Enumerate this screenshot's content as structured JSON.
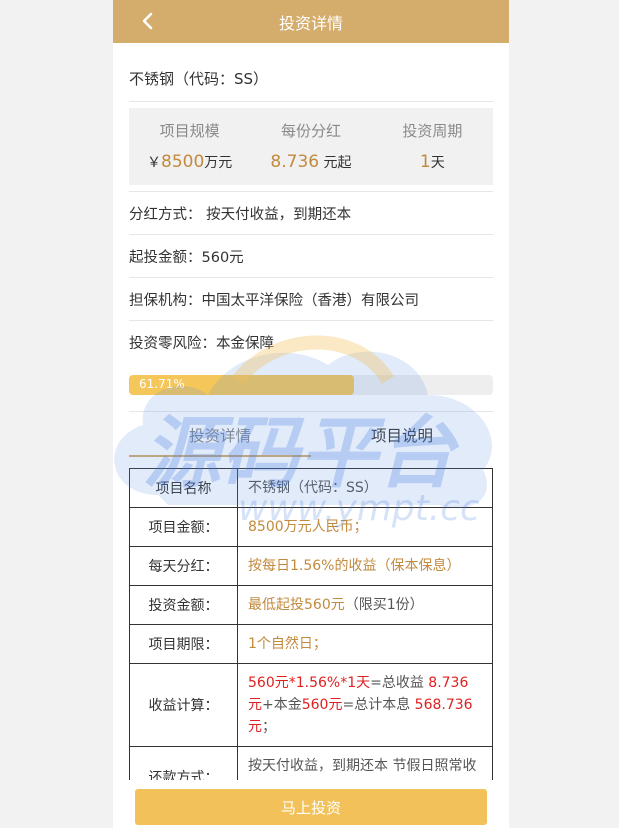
{
  "header": {
    "title": "投资详情"
  },
  "project": {
    "name": "不锈钢（代码：SS）"
  },
  "stats": [
    {
      "label": "项目规模",
      "prefix": "￥",
      "value": "8500",
      "unit": "万元"
    },
    {
      "label": "每份分红",
      "prefix": "",
      "value": "8.736",
      "unit": " 元起"
    },
    {
      "label": "投资周期",
      "prefix": "",
      "value": "1",
      "unit": "天"
    }
  ],
  "info": [
    {
      "label": "分红方式：",
      "value": "按天付收益，到期还本"
    },
    {
      "label": "起投金额：",
      "value": "560元"
    },
    {
      "label": "担保机构：",
      "value": "中国太平洋保险（香港）有限公司"
    },
    {
      "label": "投资零风险：",
      "value": "本金保障"
    }
  ],
  "progress": {
    "percent": 61.71,
    "text": "61.71%"
  },
  "tabs": [
    {
      "label": "投资详情",
      "active": true
    },
    {
      "label": "项目说明",
      "active": false
    }
  ],
  "table": {
    "header_key": "项目名称",
    "header_val": "不锈钢（代码：SS）",
    "rows": [
      {
        "key": "项目金额：",
        "val": "8500万元人民币；"
      },
      {
        "key": "每天分红：",
        "val": "按每日1.56%的收益（保本保息）"
      },
      {
        "key": "投资金额：",
        "val_a": "最低起投560元",
        "val_b": "（限买1份）"
      },
      {
        "key": "项目期限：",
        "val": "1个自然日；"
      },
      {
        "key": "收益计算：",
        "p1": "560元*1.56%*1天",
        "p2": "=总收益 ",
        "p3": "8.736 元",
        "p4": "+本金",
        "p5": "560元",
        "p6": "=总计本息 ",
        "p7": "568.736 元",
        "p8": "；"
      },
      {
        "key": "还款方式：",
        "val": "按天付收益，到期还本 节假日照常收益；"
      }
    ]
  },
  "bottom": {
    "button_label": "马上投资"
  },
  "watermark": {
    "text_main": "源码平台",
    "text_url": "www.ympt.cc"
  }
}
